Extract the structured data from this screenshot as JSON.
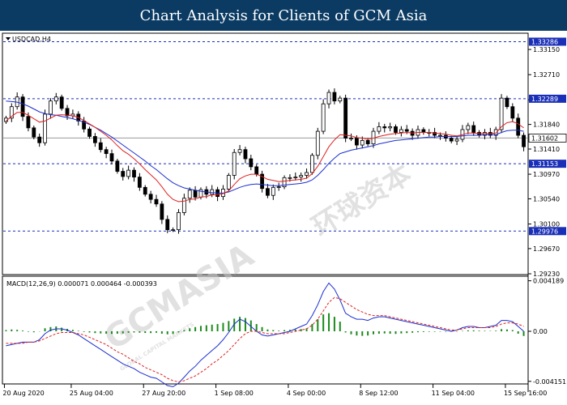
{
  "header": {
    "title": "Chart Analysis for Clients of GCM Asia"
  },
  "chart_data": [
    {
      "type": "candlestick",
      "title": "USDCAD,H4",
      "ylim": [
        1.2923,
        1.3342
      ],
      "y_ticks": [
        "1.33150",
        "1.32710",
        "1.32270",
        "1.31840",
        "1.31410",
        "1.30970",
        "1.30540",
        "1.30100",
        "1.29670",
        "1.29230"
      ],
      "x_ticks": [
        "20 Aug 2020",
        "25 Aug 04:00",
        "27 Aug 20:00",
        "1 Sep 08:00",
        "4 Sep 00:00",
        "8 Sep 12:00",
        "11 Sep 04:00",
        "15 Sep 16:00"
      ],
      "horizontal_levels": [
        {
          "value": 1.33286,
          "label": "1.33286",
          "style": "dashed",
          "color": "#1a2fb8"
        },
        {
          "value": 1.32289,
          "label": "1.32289",
          "style": "dashed",
          "color": "#1a2fb8"
        },
        {
          "value": 1.31153,
          "label": "1.31153",
          "style": "dashed",
          "color": "#1a2fb8"
        },
        {
          "value": 1.29976,
          "label": "1.29976",
          "style": "dashed",
          "color": "#1a2fb8"
        }
      ],
      "current_price": {
        "value": 1.31602,
        "label": "1.31602"
      },
      "close_series": [
        1.3195,
        1.3215,
        1.3232,
        1.3198,
        1.3178,
        1.3162,
        1.3152,
        1.3202,
        1.3225,
        1.3232,
        1.3212,
        1.3199,
        1.3202,
        1.319,
        1.3176,
        1.3163,
        1.3152,
        1.314,
        1.3133,
        1.312,
        1.3102,
        1.3093,
        1.3104,
        1.3092,
        1.3074,
        1.3062,
        1.3053,
        1.3045,
        1.3018,
        1.3,
        1.3,
        1.303,
        1.3055,
        1.3069,
        1.3057,
        1.307,
        1.3062,
        1.307,
        1.3058,
        1.3071,
        1.3095,
        1.3135,
        1.314,
        1.3124,
        1.311,
        1.3097,
        1.3072,
        1.306,
        1.3074,
        1.3075,
        1.3091,
        1.3091,
        1.3092,
        1.3095,
        1.31,
        1.313,
        1.3172,
        1.322,
        1.324,
        1.3225,
        1.323,
        1.316,
        1.316,
        1.3148,
        1.3156,
        1.315,
        1.3172,
        1.318,
        1.3178,
        1.318,
        1.317,
        1.3175,
        1.3172,
        1.3165,
        1.3175,
        1.317,
        1.317,
        1.3165,
        1.3165,
        1.316,
        1.3155,
        1.3158,
        1.3175,
        1.3182,
        1.317,
        1.3165,
        1.317,
        1.3165,
        1.3175,
        1.323,
        1.3215,
        1.3195,
        1.3165,
        1.3145
      ],
      "ma_fast": {
        "color": "#e02020",
        "values": [
          1.319,
          1.3198,
          1.3205,
          1.3205,
          1.32,
          1.3194,
          1.3188,
          1.319,
          1.3195,
          1.32,
          1.3201,
          1.32,
          1.3199,
          1.3196,
          1.3191,
          1.3185,
          1.3179,
          1.3172,
          1.3165,
          1.3157,
          1.3147,
          1.3138,
          1.3132,
          1.3124,
          1.3115,
          1.3105,
          1.3096,
          1.3087,
          1.3075,
          1.3062,
          1.3053,
          1.3049,
          1.305,
          1.3053,
          1.3054,
          1.3057,
          1.3058,
          1.3061,
          1.3061,
          1.3063,
          1.3068,
          1.3079,
          1.3089,
          1.3094,
          1.3097,
          1.3097,
          1.3093,
          1.3088,
          1.3086,
          1.3084,
          1.3085,
          1.3086,
          1.3087,
          1.3088,
          1.309,
          1.3098,
          1.3111,
          1.3128,
          1.3145,
          1.3157,
          1.3166,
          1.3165,
          1.3164,
          1.3161,
          1.316,
          1.3158,
          1.316,
          1.3163,
          1.3165,
          1.3167,
          1.3168,
          1.3169,
          1.317,
          1.3169,
          1.317,
          1.317,
          1.317,
          1.3169,
          1.3168,
          1.3167,
          1.3165,
          1.3164,
          1.3166,
          1.3169,
          1.3169,
          1.3168,
          1.3168,
          1.3168,
          1.3169,
          1.318,
          1.3187,
          1.3189,
          1.3185,
          1.3178
        ]
      },
      "ma_slow": {
        "color": "#1a2fd0",
        "values": [
          1.3225,
          1.3224,
          1.3223,
          1.322,
          1.3216,
          1.3211,
          1.3206,
          1.3203,
          1.3201,
          1.32,
          1.3198,
          1.3196,
          1.3194,
          1.3191,
          1.3188,
          1.3184,
          1.3179,
          1.3174,
          1.3168,
          1.3162,
          1.3155,
          1.3148,
          1.3141,
          1.3134,
          1.3127,
          1.312,
          1.3112,
          1.3105,
          1.3097,
          1.3089,
          1.3082,
          1.3077,
          1.3073,
          1.3071,
          1.3069,
          1.3067,
          1.3066,
          1.3065,
          1.3064,
          1.3064,
          1.3066,
          1.307,
          1.3074,
          1.3077,
          1.3079,
          1.308,
          1.3079,
          1.3078,
          1.3077,
          1.3077,
          1.3078,
          1.3079,
          1.308,
          1.3081,
          1.3083,
          1.3087,
          1.3095,
          1.3105,
          1.3116,
          1.3125,
          1.3133,
          1.3136,
          1.3139,
          1.3141,
          1.3143,
          1.3145,
          1.3147,
          1.315,
          1.3152,
          1.3154,
          1.3156,
          1.3157,
          1.3158,
          1.3159,
          1.316,
          1.3161,
          1.3162,
          1.3162,
          1.3163,
          1.3163,
          1.3163,
          1.3163,
          1.3164,
          1.3165,
          1.3165,
          1.3165,
          1.3166,
          1.3166,
          1.3166,
          1.317,
          1.3173,
          1.3174,
          1.3174,
          1.3172
        ]
      }
    },
    {
      "type": "macd",
      "label": "MACD(12,26,9) 0.000071 0.000464 -0.000393",
      "ylim": [
        -0.0043,
        0.0045
      ],
      "y_ticks": [
        {
          "value": 0.004189,
          "label": "0.004189"
        },
        {
          "value": 0.0,
          "label": "0.00"
        },
        {
          "value": -0.004151,
          "label": "-0.004151"
        }
      ],
      "histogram_color": "#1c8a1c",
      "macd_line_color": "#1a2fd0",
      "signal_line_color": "#e02020",
      "histogram": [
        0.0001,
        0.00015,
        0.00012,
        6e-05,
        -4e-05,
        -8e-05,
        -2e-05,
        0.00025,
        0.00035,
        0.0004,
        0.0003,
        0.0002,
        0.00012,
        4e-05,
        -5e-05,
        -0.0001,
        -0.00015,
        -0.00018,
        -0.0002,
        -0.00022,
        -0.0002,
        -0.00018,
        -0.00012,
        -0.0001,
        -0.00012,
        -0.00014,
        -0.00015,
        -0.00012,
        -0.0002,
        -0.00025,
        -0.00022,
        -0.0001,
        0.0001,
        0.00025,
        0.00035,
        0.00045,
        0.0005,
        0.00055,
        0.0006,
        0.0007,
        0.00085,
        0.00105,
        0.0012,
        0.0011,
        0.0009,
        0.0006,
        0.00035,
        0.00015,
        0.0001,
        5e-05,
        0.0001,
        0.00012,
        0.00015,
        0.00018,
        0.00025,
        0.0006,
        0.001,
        0.0014,
        0.0015,
        0.0012,
        0.0008,
        -0.0001,
        -0.00025,
        -0.00035,
        -0.00038,
        -0.00035,
        -0.00025,
        -0.0002,
        -0.00018,
        -0.0002,
        -0.00022,
        -0.00018,
        -0.00015,
        -0.00012,
        -8e-05,
        -6e-05,
        -4e-05,
        -4e-05,
        -3e-05,
        -4e-05,
        -4e-05,
        -3e-05,
        3e-05,
        8e-05,
        8e-05,
        5e-05,
        4e-05,
        3e-05,
        5e-05,
        0.00018,
        0.00015,
        0.0001,
        -0.0002,
        -0.00039
      ],
      "macd_line": [
        -0.0012,
        -0.0011,
        -0.001,
        -0.0009,
        -0.0009,
        -0.0009,
        -0.0007,
        -0.0002,
        0.0001,
        0.0002,
        0.0002,
        0.0001,
        -0.0001,
        -0.0003,
        -0.0006,
        -0.0009,
        -0.0012,
        -0.0015,
        -0.0018,
        -0.0021,
        -0.0024,
        -0.0027,
        -0.0029,
        -0.0031,
        -0.0034,
        -0.0036,
        -0.0038,
        -0.0039,
        -0.0042,
        -0.0045,
        -0.0046,
        -0.0043,
        -0.0038,
        -0.0033,
        -0.0029,
        -0.0024,
        -0.002,
        -0.0016,
        -0.0012,
        -0.0007,
        -0.0001,
        0.0006,
        0.001,
        0.0008,
        0.0004,
        0.0,
        -0.0003,
        -0.0004,
        -0.0003,
        -0.0002,
        -0.0001,
        0.0,
        0.0002,
        0.0004,
        0.0006,
        0.0013,
        0.0022,
        0.0033,
        0.004,
        0.0035,
        0.0026,
        0.0015,
        0.0012,
        0.001,
        0.001,
        0.0009,
        0.0011,
        0.0012,
        0.0012,
        0.0011,
        0.001,
        0.0009,
        0.0008,
        0.0007,
        0.0006,
        0.0005,
        0.0004,
        0.0003,
        0.0002,
        0.0001,
        0.0,
        0.0001,
        0.0003,
        0.0004,
        0.0004,
        0.0003,
        0.0003,
        0.0004,
        0.0005,
        0.0009,
        0.0009,
        0.0008,
        0.0004,
        0.0
      ],
      "signal_line": [
        -0.001,
        -0.001,
        -0.001,
        -0.001,
        -0.0009,
        -0.0009,
        -0.0008,
        -0.0006,
        -0.0004,
        -0.0002,
        -0.0001,
        -0.0001,
        -0.0001,
        -0.0002,
        -0.0003,
        -0.0005,
        -0.0007,
        -0.0009,
        -0.0011,
        -0.0014,
        -0.0017,
        -0.0019,
        -0.0022,
        -0.0025,
        -0.0027,
        -0.003,
        -0.0032,
        -0.0034,
        -0.0036,
        -0.0039,
        -0.0041,
        -0.0042,
        -0.0041,
        -0.0039,
        -0.0037,
        -0.0034,
        -0.0031,
        -0.0027,
        -0.0024,
        -0.002,
        -0.0016,
        -0.0011,
        -0.0006,
        -0.0002,
        0.0,
        0.0,
        -0.0001,
        -0.0002,
        -0.0002,
        -0.0002,
        -0.0002,
        -0.0001,
        0.0,
        0.0001,
        0.0002,
        0.0005,
        0.001,
        0.0017,
        0.0024,
        0.0028,
        0.0027,
        0.0024,
        0.0021,
        0.0018,
        0.0016,
        0.0014,
        0.0013,
        0.0013,
        0.0013,
        0.0012,
        0.0011,
        0.001,
        0.0009,
        0.0008,
        0.0007,
        0.0006,
        0.0005,
        0.0004,
        0.0003,
        0.0002,
        0.0001,
        0.0001,
        0.0002,
        0.0003,
        0.0003,
        0.0003,
        0.0003,
        0.0003,
        0.0004,
        0.0006,
        0.0007,
        0.0007,
        0.0006,
        0.0004
      ]
    }
  ],
  "watermark": {
    "brand": "GCMASIA",
    "tagline": "GLOBAL CAPITAL MARKETS",
    "chinese": "环球资本"
  }
}
